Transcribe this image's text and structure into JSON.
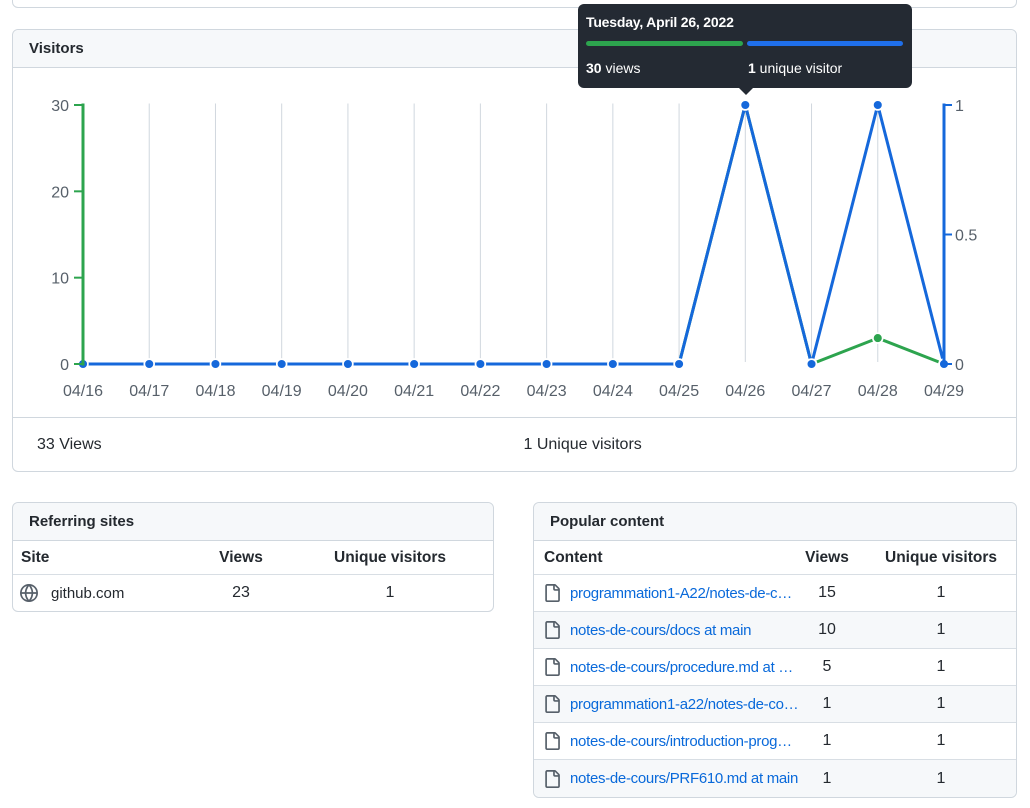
{
  "visitors_panel": {
    "title": "Visitors",
    "summary": {
      "views": "33 Views",
      "unique": "1 Unique visitors"
    }
  },
  "tooltip": {
    "date": "Tuesday, April 26, 2022",
    "views_value": "30",
    "views_suffix": " views",
    "unique_value": "1",
    "unique_suffix": " unique visitor",
    "views_color": "#2da44e",
    "unique_color": "#1f6feb",
    "background": "#242a33"
  },
  "chart_data": {
    "type": "line",
    "title": "Visitors",
    "x": [
      "04/16",
      "04/17",
      "04/18",
      "04/19",
      "04/20",
      "04/21",
      "04/22",
      "04/23",
      "04/24",
      "04/25",
      "04/26",
      "04/27",
      "04/28",
      "04/29"
    ],
    "series": [
      {
        "name": "Views",
        "axis": "left",
        "color": "#2da44e",
        "values": [
          0,
          0,
          0,
          0,
          0,
          0,
          0,
          0,
          0,
          0,
          30,
          0,
          3,
          0
        ]
      },
      {
        "name": "Unique visitors",
        "axis": "right",
        "color": "#1568db",
        "values": [
          0,
          0,
          0,
          0,
          0,
          0,
          0,
          0,
          0,
          0,
          1,
          0,
          1,
          0
        ]
      }
    ],
    "left_axis": {
      "range": [
        0,
        30
      ],
      "ticks": [
        0,
        10,
        20,
        30
      ],
      "labels": [
        "0",
        "10",
        "20",
        "30"
      ],
      "color": "#2da44e"
    },
    "right_axis": {
      "range": [
        0,
        1
      ],
      "ticks": [
        0,
        0.5,
        1
      ],
      "labels": [
        "0",
        "0.5",
        "1"
      ],
      "color": "#1568db"
    },
    "grid": true,
    "grid_color": "#d0d7de",
    "label_color": "#57606a",
    "legend_position": "none"
  },
  "referring_sites": {
    "title": "Referring sites",
    "columns": [
      "Site",
      "Views",
      "Unique visitors"
    ],
    "rows": [
      {
        "icon": "globe",
        "site": "github.com",
        "views": "23",
        "unique": "1"
      }
    ]
  },
  "popular_content": {
    "title": "Popular content",
    "columns": [
      "Content",
      "Views",
      "Unique visitors"
    ],
    "rows": [
      {
        "icon": "file",
        "content": "programmation1-A22/notes-de-c…",
        "views": "15",
        "unique": "1"
      },
      {
        "icon": "file",
        "content": "notes-de-cours/docs at main",
        "views": "10",
        "unique": "1"
      },
      {
        "icon": "file",
        "content": "notes-de-cours/procedure.md at …",
        "views": "5",
        "unique": "1"
      },
      {
        "icon": "file",
        "content": "programmation1-a22/notes-de-co…",
        "views": "1",
        "unique": "1"
      },
      {
        "icon": "file",
        "content": "notes-de-cours/introduction-prog…",
        "views": "1",
        "unique": "1"
      },
      {
        "icon": "file",
        "content": "notes-de-cours/PRF610.md at main",
        "views": "1",
        "unique": "1"
      }
    ]
  }
}
